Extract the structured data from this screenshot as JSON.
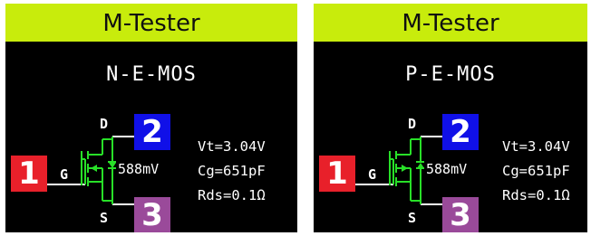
{
  "colors": {
    "title_bar": "#c8ec0c",
    "screen_bg": "#000000",
    "symbol_green": "#28e028",
    "wire_white": "#ffffff",
    "pin1": "#e8202a",
    "pin2": "#1010e8",
    "pin3": "#9a4a9a"
  },
  "screens": [
    {
      "title": "M-Tester",
      "mode": "N-E-MOS",
      "pins": {
        "drain": "D",
        "gate": "G",
        "source": "S"
      },
      "badges": [
        "1",
        "2",
        "3"
      ],
      "vth_inline": "588mV",
      "readings": {
        "vt": "Vt=3.04V",
        "cg": "Cg=651pF",
        "rds": "Rds=0.1Ω"
      }
    },
    {
      "title": "M-Tester",
      "mode": "P-E-MOS",
      "pins": {
        "drain": "D",
        "gate": "G",
        "source": "S"
      },
      "badges": [
        "1",
        "2",
        "3"
      ],
      "vth_inline": "588mV",
      "readings": {
        "vt": "Vt=3.04V",
        "cg": "Cg=651pF",
        "rds": "Rds=0.1Ω"
      }
    }
  ]
}
